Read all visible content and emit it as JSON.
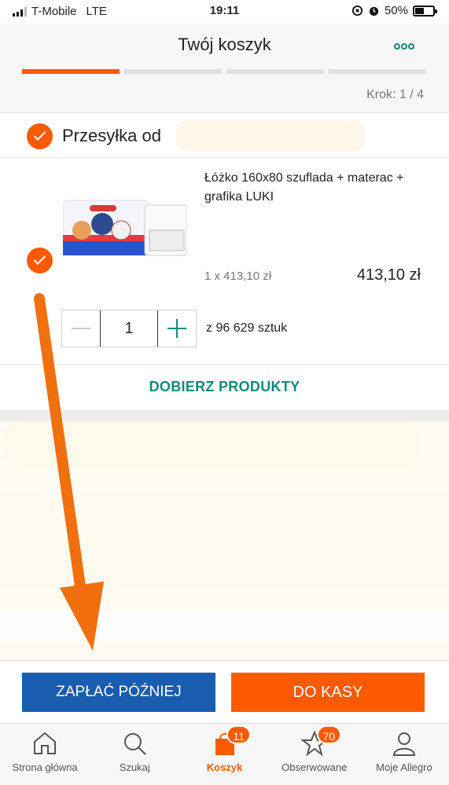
{
  "status_bar": {
    "carrier": "T-Mobile",
    "network": "LTE",
    "time": "19:11",
    "battery": "50%",
    "battery_level": 0.5
  },
  "header": {
    "title": "Twój koszyk",
    "more_icon": "more-dots-icon"
  },
  "steps": {
    "current": 1,
    "total": 4,
    "label": "Krok: 1 / 4"
  },
  "seller": {
    "label": "Przesyłka od"
  },
  "product": {
    "name": "Łóżko 160x80 szuflada + materac + grafika LUKI",
    "unit_price": "1 x 413,10 zł",
    "total_price": "413,10 zł",
    "quantity": "1",
    "stock": "z 96 629 sztuk"
  },
  "more_products": "DOBIERZ PRODUKTY",
  "buttons": {
    "pay_later": "ZAPŁAĆ PÓŹNIEJ",
    "checkout": "DO KASY"
  },
  "tabs": [
    {
      "label": "Strona główna",
      "icon": "home-icon"
    },
    {
      "label": "Szukaj",
      "icon": "search-icon"
    },
    {
      "label": "Koszyk",
      "icon": "cart-icon",
      "badge": "11"
    },
    {
      "label": "Obserwowane",
      "icon": "star-icon",
      "badge": "70"
    },
    {
      "label": "Moje Allegro",
      "icon": "user-icon"
    }
  ],
  "colors": {
    "accent": "#ff5a00",
    "teal": "#0e8b7a",
    "blue": "#1a5cae"
  }
}
